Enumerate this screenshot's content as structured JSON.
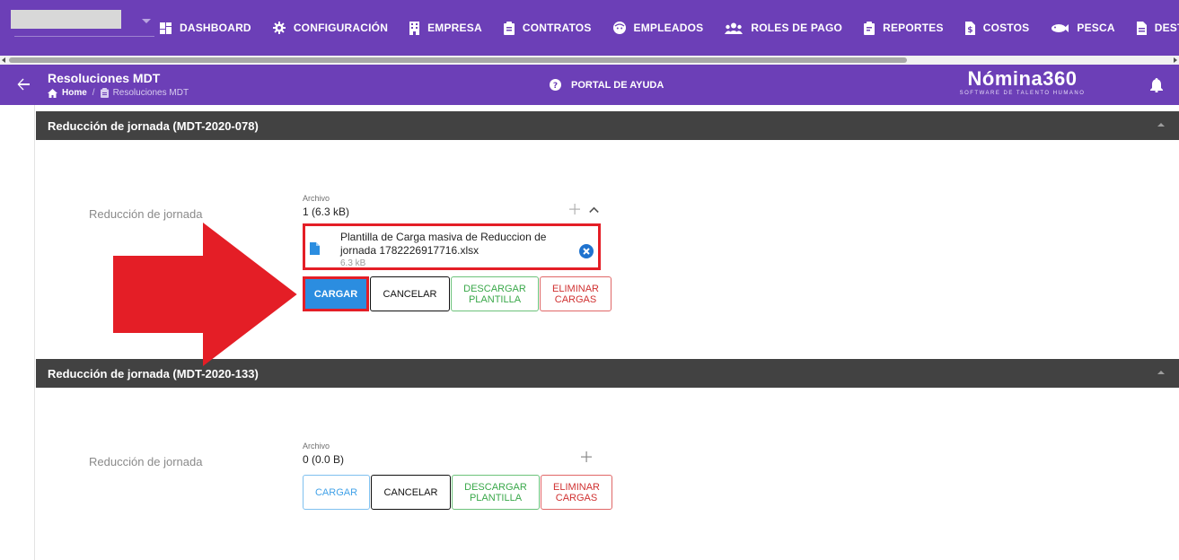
{
  "nav": {
    "items": [
      {
        "label": "DASHBOARD",
        "icon": "dashboard-icon"
      },
      {
        "label": "CONFIGURACIÓN",
        "icon": "gear-icon"
      },
      {
        "label": "EMPRESA",
        "icon": "building-icon"
      },
      {
        "label": "CONTRATOS",
        "icon": "clipboard-icon"
      },
      {
        "label": "EMPLEADOS",
        "icon": "face-icon"
      },
      {
        "label": "ROLES DE PAGO",
        "icon": "people-icon"
      },
      {
        "label": "REPORTES",
        "icon": "report-icon"
      },
      {
        "label": "COSTOS",
        "icon": "dollar-doc-icon"
      },
      {
        "label": "PESCA",
        "icon": "fish-icon"
      },
      {
        "label": "DESTAJO",
        "icon": "document-icon"
      }
    ]
  },
  "header": {
    "title": "Resoluciones MDT",
    "breadcrumb_home": "Home",
    "breadcrumb_current": "Resoluciones MDT",
    "help_label": "PORTAL DE AYUDA",
    "logo_main": "Nómina360",
    "logo_sub": "SOFTWARE DE TALENTO HUMANO"
  },
  "sections": [
    {
      "title": "Reducción de jornada (MDT-2020-078)",
      "row_label": "Reducción de jornada",
      "file_caption": "Archivo",
      "file_count": "1 (6.3 kB)",
      "file": {
        "name": "Plantilla de Carga masiva de Reduccion de jornada 1782226917716.xlsx",
        "size": "6.3 kB"
      },
      "buttons": {
        "cargar": "CARGAR",
        "cancelar": "CANCELAR",
        "descargar": "DESCARGAR PLANTILLA",
        "eliminar": "ELIMINAR CARGAS"
      }
    },
    {
      "title": "Reducción de jornada (MDT-2020-133)",
      "row_label": "Reducción de jornada",
      "file_caption": "Archivo",
      "file_count": "0 (0.0 B)",
      "buttons": {
        "cargar": "CARGAR",
        "cancelar": "CANCELAR",
        "descargar": "DESCARGAR PLANTILLA",
        "eliminar": "ELIMINAR CARGAS"
      }
    }
  ],
  "colors": {
    "brand_purple": "#6c3fb7",
    "section_header": "#424242",
    "highlight_red": "#e41e26",
    "primary_blue": "#2b8de0"
  }
}
